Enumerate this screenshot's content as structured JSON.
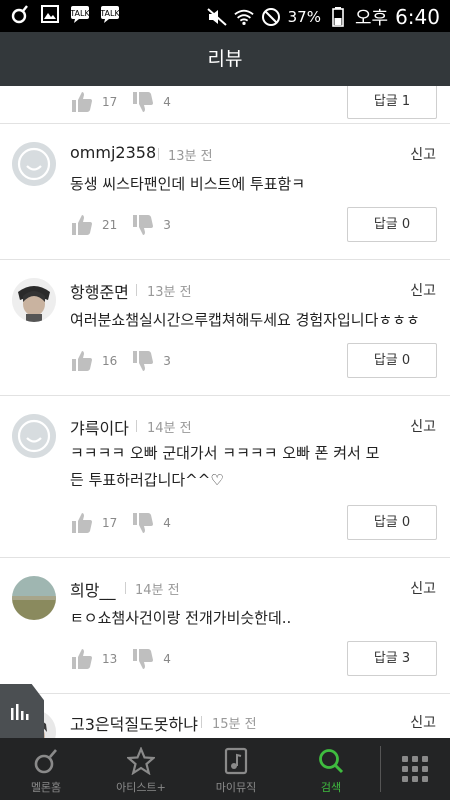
{
  "status_bar": {
    "battery": "37%",
    "ampm": "오후",
    "time": "6:40",
    "left_icons": [
      "melon-icon",
      "image-icon",
      "talk-icon",
      "talk-icon"
    ],
    "right_icons": [
      "mute-icon",
      "wifi-icon",
      "blocked-icon",
      "battery-icon"
    ]
  },
  "header": {
    "title": "리뷰"
  },
  "reply_label": "답글",
  "report_label": "신고",
  "partial_top": {
    "likes": "17",
    "dislikes": "4",
    "reply_count": "1"
  },
  "comments": [
    {
      "username": "ommj2358",
      "time": "13분 전",
      "text": "동생 씨스타팬인데 비스트에 투표함ㅋ",
      "likes": "21",
      "dislikes": "3",
      "reply_count": "0",
      "avatar": "default-avatar"
    },
    {
      "username": "항행준면",
      "time": "13분 전",
      "text": "여러분쇼챔실시간으루캡쳐해두세요 경험자입니다ㅎㅎㅎ",
      "likes": "16",
      "dislikes": "3",
      "reply_count": "0",
      "avatar": "photo-avatar"
    },
    {
      "username": "갸륵이다",
      "time": "14분 전",
      "text": "ㅋㅋㅋㅋ 오빠 군대가서 ㅋㅋㅋㅋ 오빠 폰 켜서 모든 투표하러갑니다^^♡",
      "likes": "17",
      "dislikes": "4",
      "reply_count": "0",
      "avatar": "default-avatar"
    },
    {
      "username": "희망__",
      "time": "14분 전",
      "text": "ㅌㅇ쇼챔사건이랑 전개가비슷한데..",
      "likes": "13",
      "dislikes": "4",
      "reply_count": "3",
      "avatar": "landscape-avatar"
    },
    {
      "username": "고3은덕질도못하냐",
      "time": "15분 전",
      "avatar": "photo-avatar"
    }
  ],
  "bottom_nav": [
    {
      "label": "멜론홈",
      "icon": "melon-home-icon",
      "active": false
    },
    {
      "label": "아티스트+",
      "icon": "star-icon",
      "active": false
    },
    {
      "label": "마이뮤직",
      "icon": "music-note-icon",
      "active": false
    },
    {
      "label": "검색",
      "icon": "search-icon",
      "active": true
    }
  ],
  "colors": {
    "header_bg": "#33383b",
    "nav_bg": "#232425",
    "accent": "#3fbc3f"
  }
}
